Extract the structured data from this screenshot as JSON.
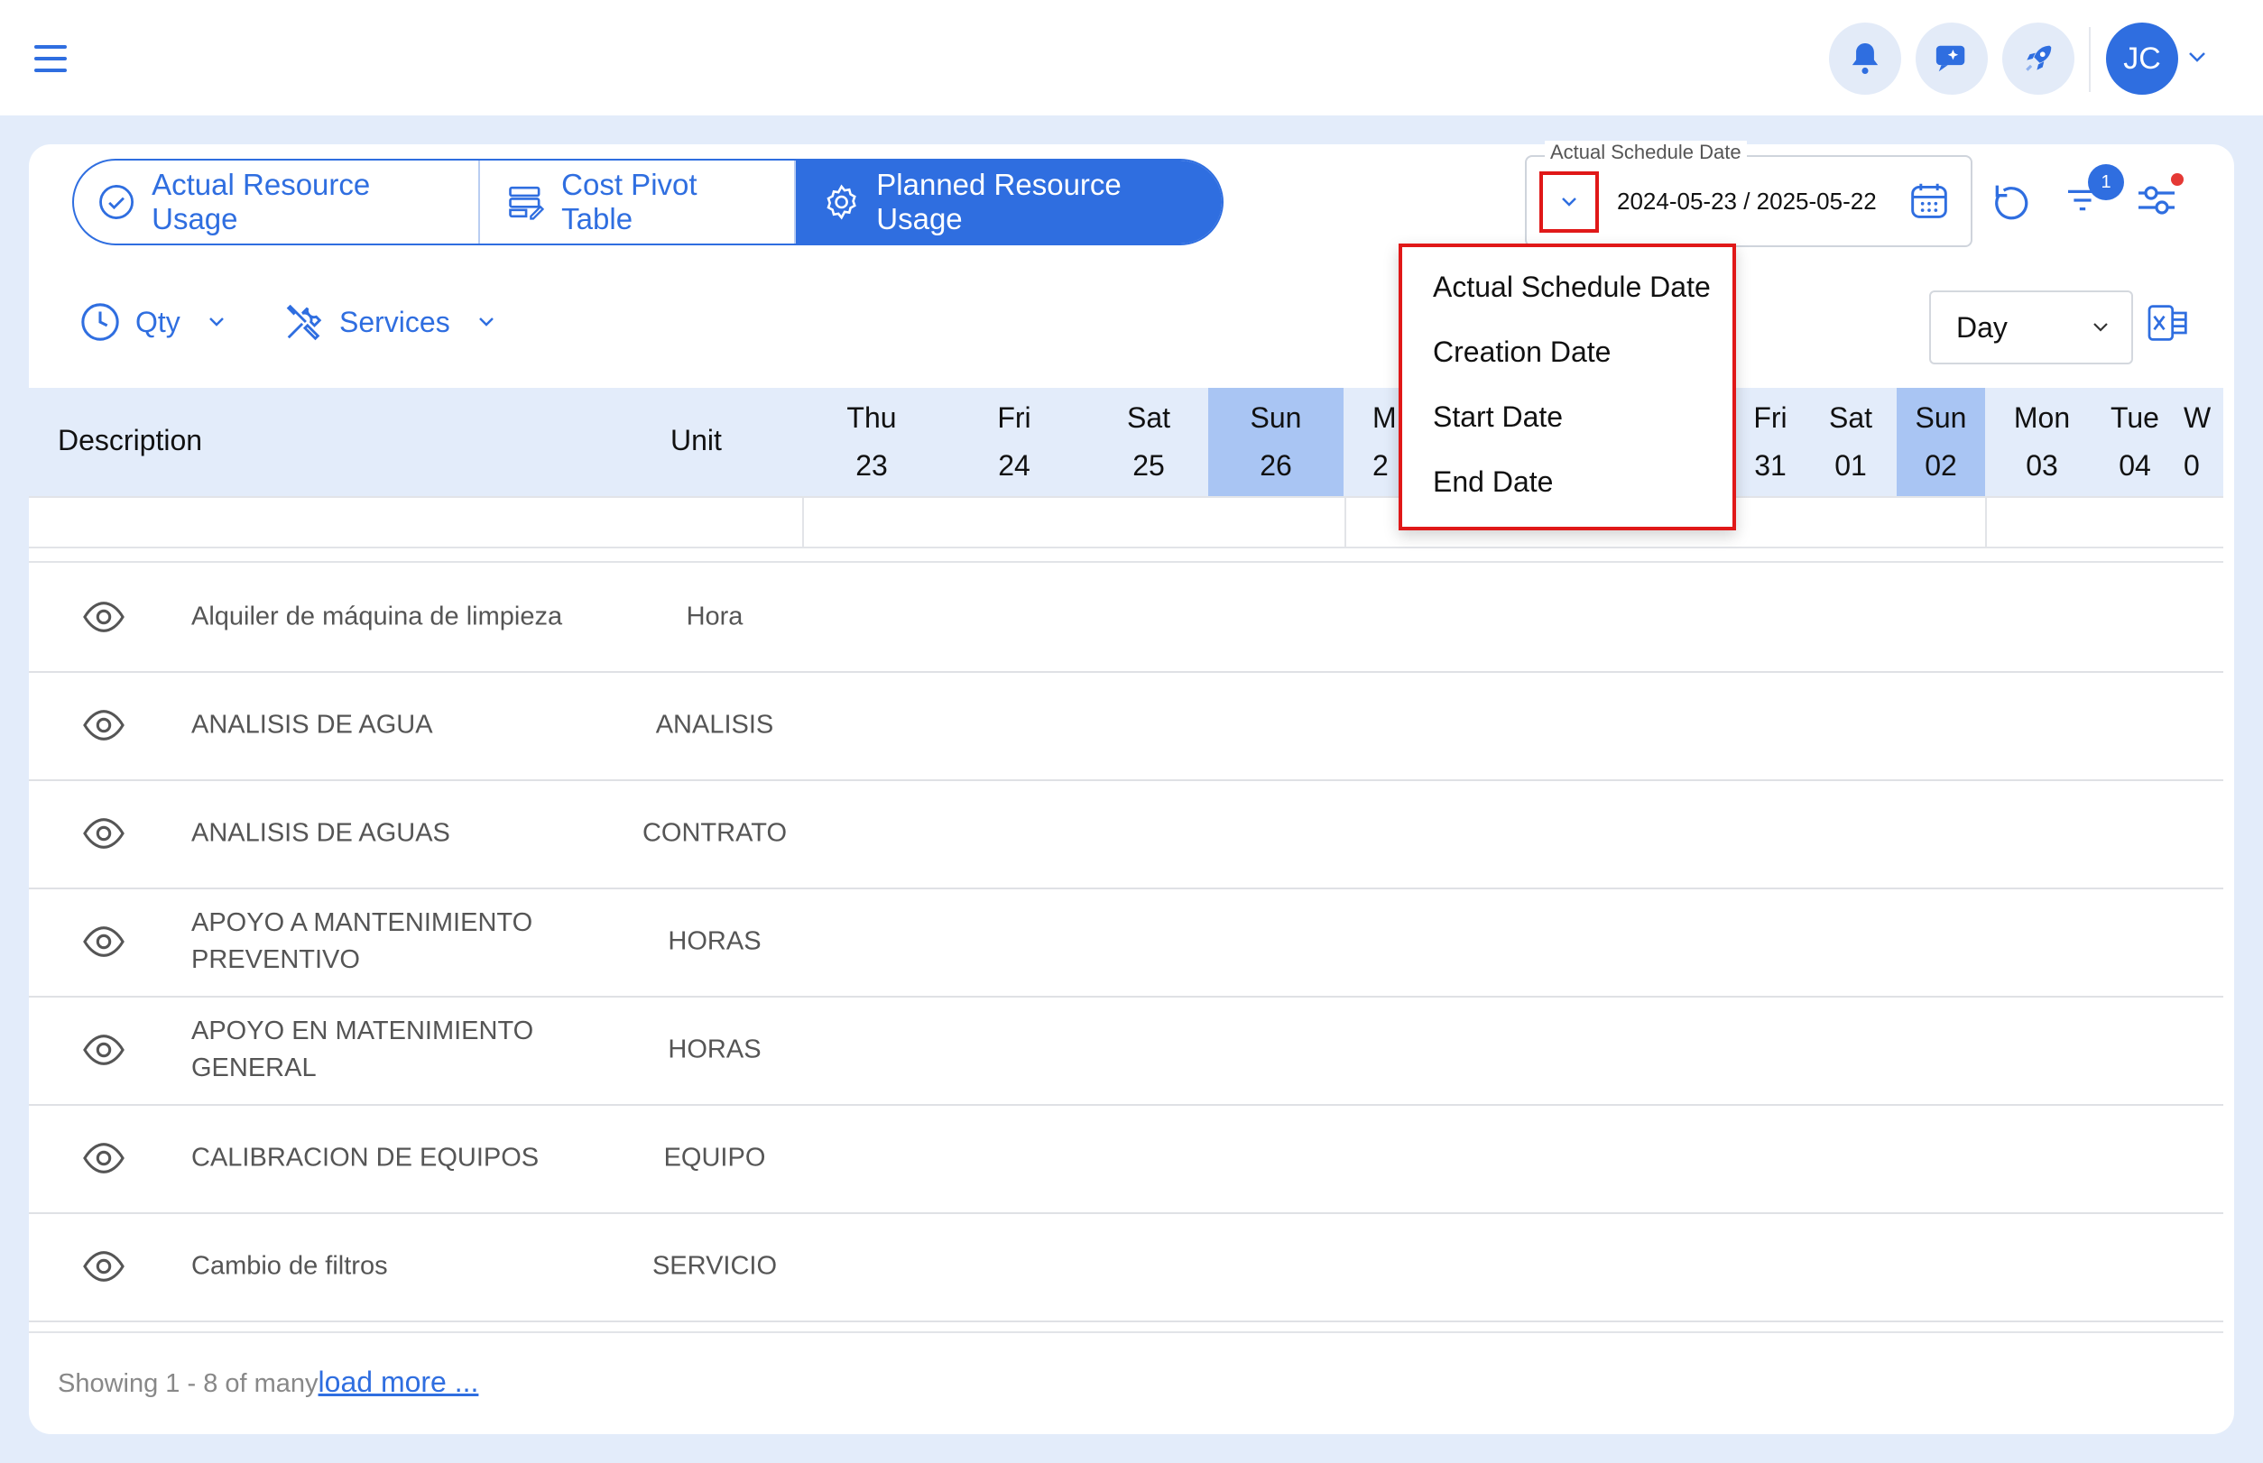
{
  "header": {
    "avatar_initials": "JC"
  },
  "tabs": [
    {
      "label": "Actual Resource Usage"
    },
    {
      "label": "Cost Pivot Table"
    },
    {
      "label": "Planned Resource Usage"
    }
  ],
  "date_filter": {
    "legend": "Actual Schedule Date",
    "range": "2024-05-23 / 2025-05-22",
    "filter_badge": "1"
  },
  "dropdown_menu": {
    "items": [
      "Actual Schedule Date",
      "Creation Date",
      "Start Date",
      "End Date"
    ]
  },
  "filters": {
    "qty_label": "Qty",
    "services_label": "Services",
    "period_selected": "Day"
  },
  "grid": {
    "col_description": "Description",
    "col_unit": "Unit",
    "days": [
      {
        "dow": "Thu",
        "day": "23"
      },
      {
        "dow": "Fri",
        "day": "24"
      },
      {
        "dow": "Sat",
        "day": "25"
      },
      {
        "dow": "Sun",
        "day": "26"
      },
      {
        "dow": "M",
        "day": "2"
      },
      {
        "dow": "Fri",
        "day": "31"
      },
      {
        "dow": "Sat",
        "day": "01"
      },
      {
        "dow": "Sun",
        "day": "02"
      },
      {
        "dow": "Mon",
        "day": "03"
      },
      {
        "dow": "Tue",
        "day": "04"
      },
      {
        "dow": "W",
        "day": "0"
      }
    ],
    "rows": [
      {
        "description": "Alquiler de máquina de limpieza",
        "unit": "Hora"
      },
      {
        "description": "ANALISIS DE AGUA",
        "unit": "ANALISIS"
      },
      {
        "description": "ANALISIS DE AGUAS",
        "unit": "CONTRATO"
      },
      {
        "description": "APOYO A MANTENIMIENTO PREVENTIVO",
        "unit": "HORAS"
      },
      {
        "description": "APOYO EN MATENIMIENTO GENERAL",
        "unit": "HORAS"
      },
      {
        "description": "CALIBRACION DE EQUIPOS",
        "unit": "EQUIPO"
      },
      {
        "description": "Cambio de filtros",
        "unit": "SERVICIO"
      }
    ]
  },
  "footer": {
    "showing": "Showing 1 - 8 of many",
    "load_more": "load more ..."
  },
  "colors": {
    "accent": "#2f6ee0",
    "highlight_column": "#a9c5f3",
    "menu_border": "#e01818"
  }
}
